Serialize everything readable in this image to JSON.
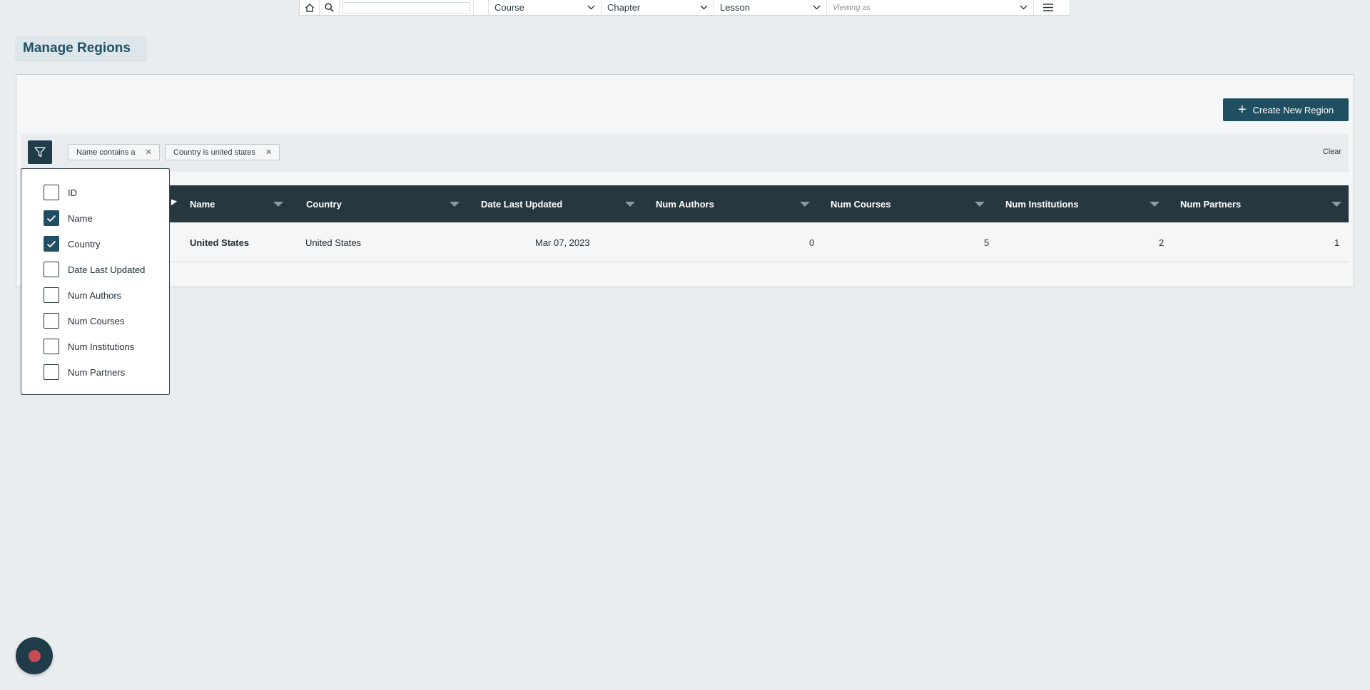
{
  "topbar": {
    "search_placeholder": "",
    "course_label": "Course",
    "chapter_label": "Chapter",
    "lesson_label": "Lesson",
    "viewing_as_placeholder": "Viewing as"
  },
  "page": {
    "title": "Manage Regions"
  },
  "toolbar": {
    "create_label": "Create New Region",
    "clear_label": "Clear"
  },
  "filters": [
    {
      "label": "Name contains a"
    },
    {
      "label": "Country is united states"
    }
  ],
  "table": {
    "columns": [
      {
        "label": "Name"
      },
      {
        "label": "Country"
      },
      {
        "label": "Date Last Updated"
      },
      {
        "label": "Num Authors"
      },
      {
        "label": "Num Courses"
      },
      {
        "label": "Num Institutions"
      },
      {
        "label": "Num Partners"
      }
    ],
    "rows": [
      {
        "name": "United States",
        "country": "United States",
        "date_last_updated": "Mar 07, 2023",
        "num_authors": "0",
        "num_courses": "5",
        "num_institutions": "2",
        "num_partners": "1"
      }
    ]
  },
  "column_menu": {
    "items": [
      {
        "label": "ID",
        "checked": false
      },
      {
        "label": "Name",
        "checked": true
      },
      {
        "label": "Country",
        "checked": true
      },
      {
        "label": "Date Last Updated",
        "checked": false
      },
      {
        "label": "Num Authors",
        "checked": false
      },
      {
        "label": "Num Courses",
        "checked": false
      },
      {
        "label": "Num Institutions",
        "checked": false
      },
      {
        "label": "Num Partners",
        "checked": false
      }
    ]
  },
  "colors": {
    "accent": "#1f4f60",
    "header_bg": "#273740",
    "page_bg": "#e9edf0",
    "fab_dot": "#c84b55"
  }
}
